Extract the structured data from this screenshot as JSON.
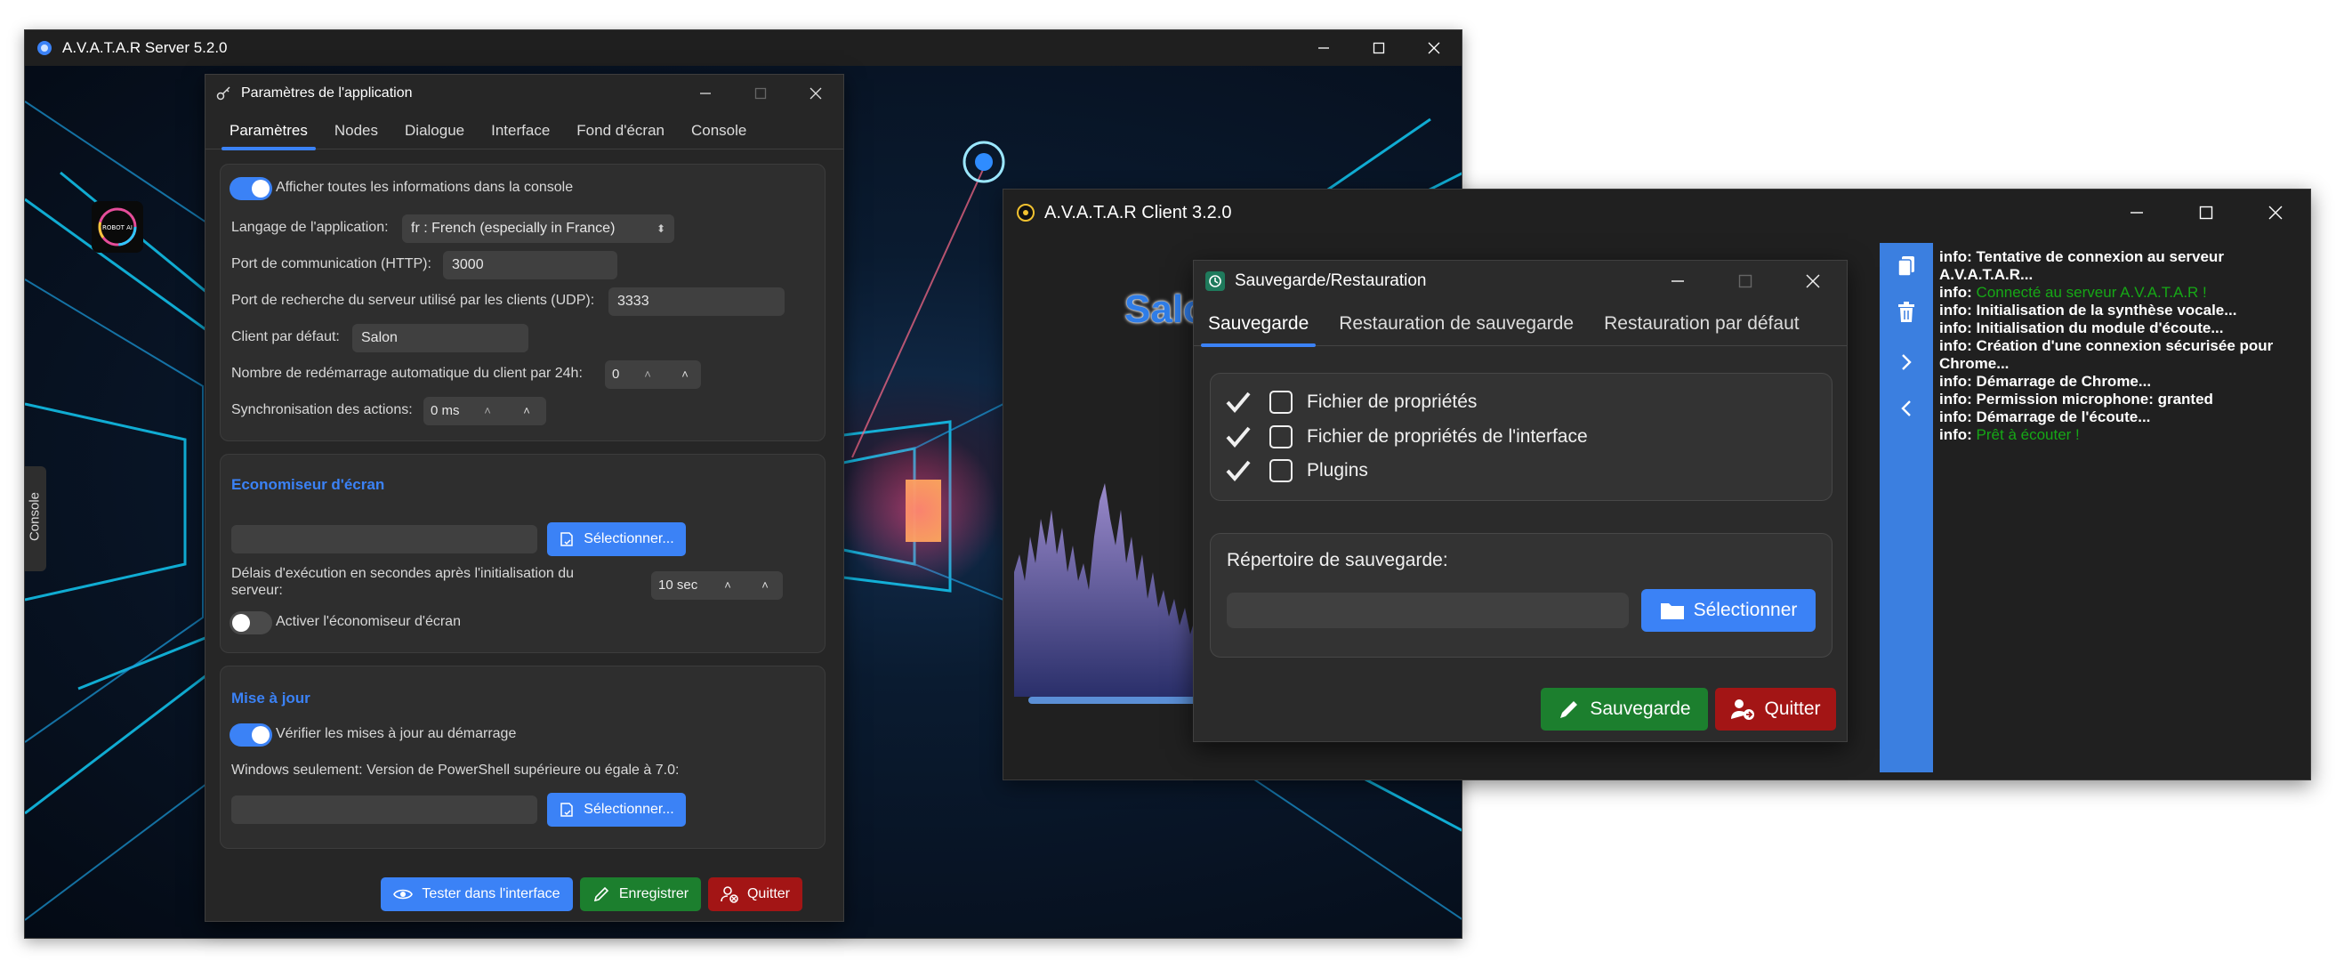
{
  "server": {
    "title": "A.V.A.T.A.R Server 5.2.0",
    "console_tab": "Console",
    "logo_text": "ROBOT AI"
  },
  "settings": {
    "title": "Paramètres de l'application",
    "tabs": [
      "Paramètres",
      "Nodes",
      "Dialogue",
      "Interface",
      "Fond d'écran",
      "Console"
    ],
    "show_all_info": "Afficher toutes les informations dans la console",
    "language_label": "Langage de l'application:",
    "language_value": "fr : French (especially in France)",
    "http_port_label": "Port de communication (HTTP):",
    "http_port_value": "3000",
    "udp_port_label": "Port de recherche du serveur utilisé par les clients (UDP):",
    "udp_port_value": "3333",
    "default_client_label": "Client par défaut:",
    "default_client_value": "Salon",
    "restart_label": "Nombre de redémarrage automatique du client par 24h:",
    "restart_value": "0",
    "sync_label": "Synchronisation des actions:",
    "sync_value": "0 ms",
    "screensaver_title": "Economiseur d'écran",
    "select_label": "Sélectionner...",
    "delay_label": "Délais d'exécution en secondes après l'initialisation du serveur:",
    "delay_value": "10 sec",
    "activate_screensaver": "Activer l'économiseur d'écran",
    "update_title": "Mise à jour",
    "check_updates": "Vérifier les mises à jour au démarrage",
    "powershell_label": "Windows seulement: Version de PowerShell supérieure ou égale à 7.0:",
    "test_button": "Tester dans l'interface",
    "save_button": "Enregistrer",
    "quit_button": "Quitter"
  },
  "client": {
    "title": "A.V.A.T.A.R Client 3.2.0",
    "salon": "Salo",
    "log": [
      {
        "prefix": "info: ",
        "text": "Tentative de connexion au serveur A.V.A.T.A.R...",
        "green": false
      },
      {
        "prefix": "info: ",
        "text": "Connecté au serveur A.V.A.T.A.R !",
        "green": true
      },
      {
        "prefix": "info: ",
        "text": "Initialisation de la synthèse vocale...",
        "green": false
      },
      {
        "prefix": "info: ",
        "text": "Initialisation du module d'écoute...",
        "green": false
      },
      {
        "prefix": "info: ",
        "text": "Création d'une connexion sécurisée pour Chrome...",
        "green": false
      },
      {
        "prefix": "info: ",
        "text": "Démarrage de Chrome...",
        "green": false
      },
      {
        "prefix": "info: ",
        "text": "Permission microphone: granted",
        "green": false
      },
      {
        "prefix": "info: ",
        "text": "Démarrage de l'écoute...",
        "green": false
      },
      {
        "prefix": "info: ",
        "text": "Prêt à écouter !",
        "green": true
      }
    ]
  },
  "backup": {
    "title": "Sauvegarde/Restauration",
    "tabs": [
      "Sauvegarde",
      "Restauration de sauvegarde",
      "Restauration par défaut"
    ],
    "items": [
      "Fichier de propriétés",
      "Fichier de propriétés de l'interface",
      "Plugins"
    ],
    "directory_label": "Répertoire de sauvegarde:",
    "directory_value": "",
    "select_button": "Sélectionner",
    "save_button": "Sauvegarde",
    "quit_button": "Quitter"
  },
  "colors": {
    "accent": "#3b82f6",
    "save_green": "#1c7f2e",
    "quit_red": "#a31515",
    "log_green": "#16a816"
  }
}
